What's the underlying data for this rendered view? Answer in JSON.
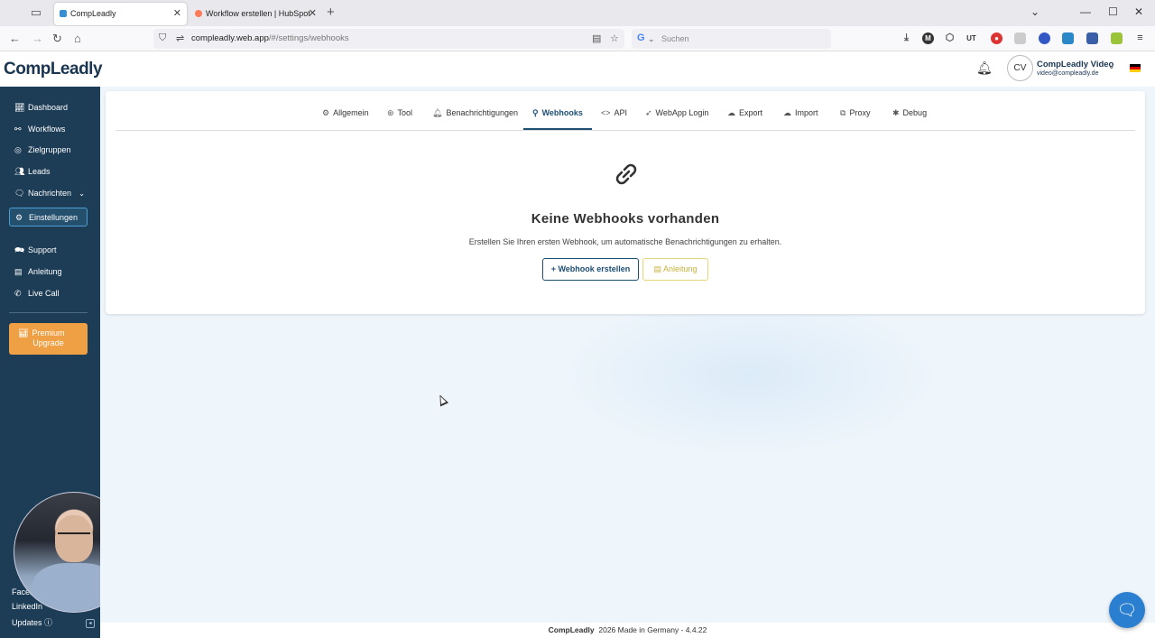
{
  "browser": {
    "tabs": [
      {
        "title": "CompLeadly",
        "active": true
      },
      {
        "title": "Workflow erstellen | HubSpot",
        "active": false
      }
    ],
    "url_host": "compleadly.web.app",
    "url_path": "/#/settings/webhooks",
    "search_placeholder": "Suchen",
    "search_engine": "G"
  },
  "header": {
    "logo": "CompLeadly",
    "avatar_initials": "CV",
    "user_name": "CompLeadly Video",
    "user_email": "video@compleadly.de"
  },
  "sidebar": {
    "items": [
      {
        "label": "Dashboard",
        "icon": "chart-icon"
      },
      {
        "label": "Workflows",
        "icon": "workflow-icon"
      },
      {
        "label": "Zielgruppen",
        "icon": "target-icon"
      },
      {
        "label": "Leads",
        "icon": "users-icon"
      },
      {
        "label": "Nachrichten",
        "icon": "messages-icon"
      },
      {
        "label": "Einstellungen",
        "icon": "gear-icon"
      },
      {
        "label": "Support",
        "icon": "support-icon"
      },
      {
        "label": "Anleitung",
        "icon": "book-icon"
      },
      {
        "label": "Live Call",
        "icon": "phone-icon"
      }
    ],
    "premium_line1": "Premium",
    "premium_line2": "Upgrade",
    "footer_links": [
      "Facebook",
      "LinkedIn",
      "Updates"
    ]
  },
  "settings_tabs": [
    {
      "label": "Allgemein",
      "icon": "gear-icon"
    },
    {
      "label": "Tool",
      "icon": "tool-icon"
    },
    {
      "label": "Benachrichtigungen",
      "icon": "bell-icon"
    },
    {
      "label": "Webhooks",
      "icon": "webhook-icon",
      "active": true
    },
    {
      "label": "API",
      "icon": "code-icon"
    },
    {
      "label": "WebApp Login",
      "icon": "rocket-icon"
    },
    {
      "label": "Export",
      "icon": "cloud-download-icon"
    },
    {
      "label": "Import",
      "icon": "cloud-upload-icon"
    },
    {
      "label": "Proxy",
      "icon": "network-icon"
    },
    {
      "label": "Debug",
      "icon": "bug-icon"
    }
  ],
  "empty_state": {
    "title": "Keine Webhooks vorhanden",
    "subtitle": "Erstellen Sie Ihren ersten Webhook, um automatische Benachrichtigungen zu erhalten.",
    "primary_button": "Webhook erstellen",
    "secondary_button": "Anleitung"
  },
  "footer": {
    "brand": "CompLeadly",
    "text": "2026 Made in Germany - 4.4.22"
  },
  "colors": {
    "sidebar_bg": "#1d3d56",
    "accent": "#1d4f73",
    "premium": "#f0a044",
    "chat": "#2b7fd1"
  }
}
